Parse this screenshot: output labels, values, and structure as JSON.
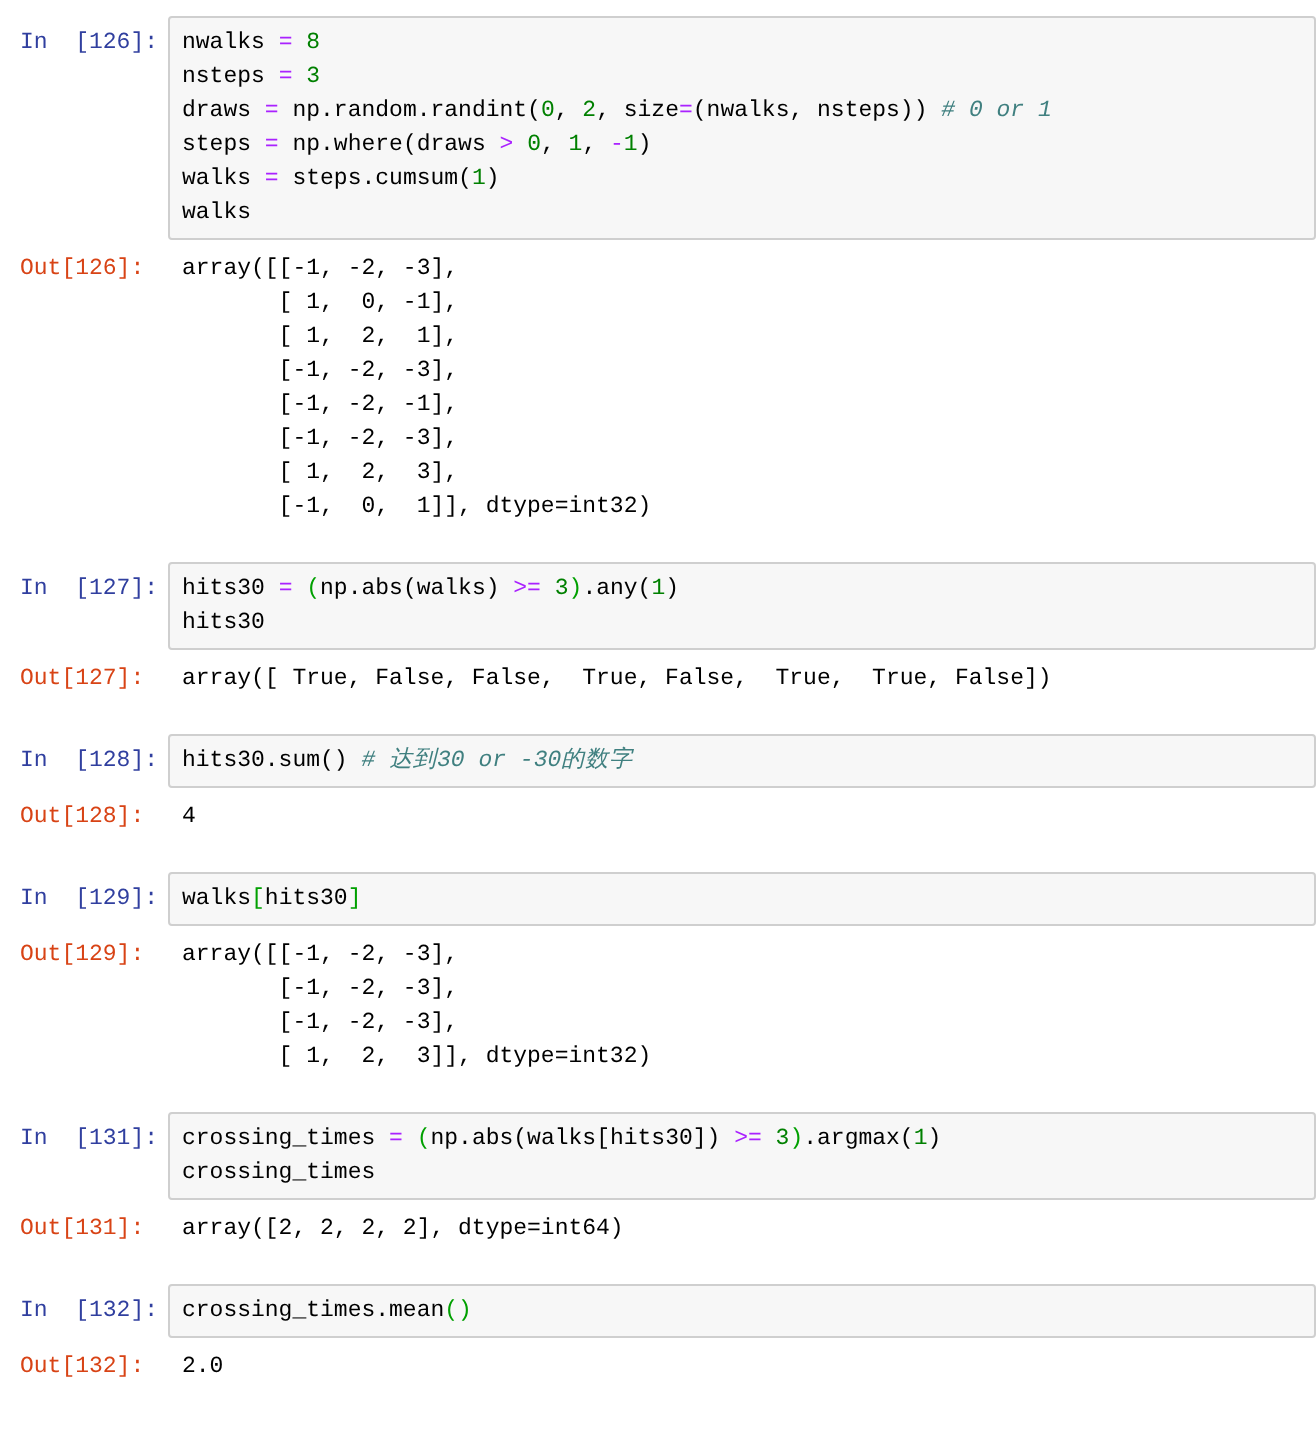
{
  "cells": [
    {
      "in_prompt": "In  [126]:",
      "code": [
        [
          {
            "kind": "plain",
            "text": "nwalks "
          },
          {
            "kind": "op",
            "text": "= "
          },
          {
            "kind": "num",
            "text": "8"
          }
        ],
        [
          {
            "kind": "plain",
            "text": "nsteps "
          },
          {
            "kind": "op",
            "text": "= "
          },
          {
            "kind": "num",
            "text": "3"
          }
        ],
        [
          {
            "kind": "plain",
            "text": "draws "
          },
          {
            "kind": "op",
            "text": "="
          },
          {
            "kind": "plain",
            "text": " np.random.randint("
          },
          {
            "kind": "num",
            "text": "0"
          },
          {
            "kind": "plain",
            "text": ", "
          },
          {
            "kind": "num",
            "text": "2"
          },
          {
            "kind": "plain",
            "text": ", size"
          },
          {
            "kind": "op",
            "text": "="
          },
          {
            "kind": "plain",
            "text": "(nwalks, nsteps)) "
          },
          {
            "kind": "comment",
            "text": "# 0 or 1"
          }
        ],
        [
          {
            "kind": "plain",
            "text": "steps "
          },
          {
            "kind": "op",
            "text": "="
          },
          {
            "kind": "plain",
            "text": " np.where(draws "
          },
          {
            "kind": "op",
            "text": "> "
          },
          {
            "kind": "num",
            "text": "0"
          },
          {
            "kind": "plain",
            "text": ", "
          },
          {
            "kind": "num",
            "text": "1"
          },
          {
            "kind": "plain",
            "text": ", "
          },
          {
            "kind": "op",
            "text": "-"
          },
          {
            "kind": "num",
            "text": "1"
          },
          {
            "kind": "plain",
            "text": ")"
          }
        ],
        [
          {
            "kind": "plain",
            "text": "walks "
          },
          {
            "kind": "op",
            "text": "="
          },
          {
            "kind": "plain",
            "text": " steps.cumsum("
          },
          {
            "kind": "num",
            "text": "1"
          },
          {
            "kind": "plain",
            "text": ")"
          }
        ],
        [
          {
            "kind": "plain",
            "text": "walks"
          }
        ]
      ],
      "out_prompt": "Out[126]:",
      "output": [
        "array([[-1, -2, -3],",
        "       [ 1,  0, -1],",
        "       [ 1,  2,  1],",
        "       [-1, -2, -3],",
        "       [-1, -2, -1],",
        "       [-1, -2, -3],",
        "       [ 1,  2,  3],",
        "       [-1,  0,  1]], dtype=int32)"
      ]
    },
    {
      "in_prompt": "In  [127]:",
      "code": [
        [
          {
            "kind": "plain",
            "text": "hits30 "
          },
          {
            "kind": "op",
            "text": "= "
          },
          {
            "kind": "match",
            "text": "("
          },
          {
            "kind": "plain",
            "text": "np.abs(walks) "
          },
          {
            "kind": "op",
            "text": ">= "
          },
          {
            "kind": "num",
            "text": "3"
          },
          {
            "kind": "match",
            "text": ")"
          },
          {
            "kind": "plain",
            "text": ".any("
          },
          {
            "kind": "num",
            "text": "1"
          },
          {
            "kind": "plain",
            "text": ")"
          }
        ],
        [
          {
            "kind": "plain",
            "text": "hits30"
          }
        ]
      ],
      "out_prompt": "Out[127]:",
      "output": [
        "array([ True, False, False,  True, False,  True,  True, False])"
      ]
    },
    {
      "in_prompt": "In  [128]:",
      "code": [
        [
          {
            "kind": "plain",
            "text": "hits30.sum() "
          },
          {
            "kind": "comment",
            "text": "# 达到30 or -30的数字"
          }
        ]
      ],
      "out_prompt": "Out[128]:",
      "output": [
        "4"
      ]
    },
    {
      "in_prompt": "In  [129]:",
      "code": [
        [
          {
            "kind": "plain",
            "text": "walks"
          },
          {
            "kind": "match",
            "text": "["
          },
          {
            "kind": "plain",
            "text": "hits30"
          },
          {
            "kind": "match",
            "text": "]"
          }
        ]
      ],
      "out_prompt": "Out[129]:",
      "output": [
        "array([[-1, -2, -3],",
        "       [-1, -2, -3],",
        "       [-1, -2, -3],",
        "       [ 1,  2,  3]], dtype=int32)"
      ]
    },
    {
      "in_prompt": "In  [131]:",
      "code": [
        [
          {
            "kind": "plain",
            "text": "crossing_times "
          },
          {
            "kind": "op",
            "text": "= "
          },
          {
            "kind": "match",
            "text": "("
          },
          {
            "kind": "plain",
            "text": "np.abs(walks[hits30]) "
          },
          {
            "kind": "op",
            "text": ">= "
          },
          {
            "kind": "num",
            "text": "3"
          },
          {
            "kind": "match",
            "text": ")"
          },
          {
            "kind": "plain",
            "text": ".argmax("
          },
          {
            "kind": "num",
            "text": "1"
          },
          {
            "kind": "plain",
            "text": ")"
          }
        ],
        [
          {
            "kind": "plain",
            "text": "crossing_times"
          }
        ]
      ],
      "out_prompt": "Out[131]:",
      "output": [
        "array([2, 2, 2, 2], dtype=int64)"
      ]
    },
    {
      "in_prompt": "In  [132]:",
      "code": [
        [
          {
            "kind": "plain",
            "text": "crossing_times.mean"
          },
          {
            "kind": "match",
            "text": "()"
          }
        ]
      ],
      "out_prompt": "Out[132]:",
      "output": [
        "2.0"
      ]
    }
  ]
}
